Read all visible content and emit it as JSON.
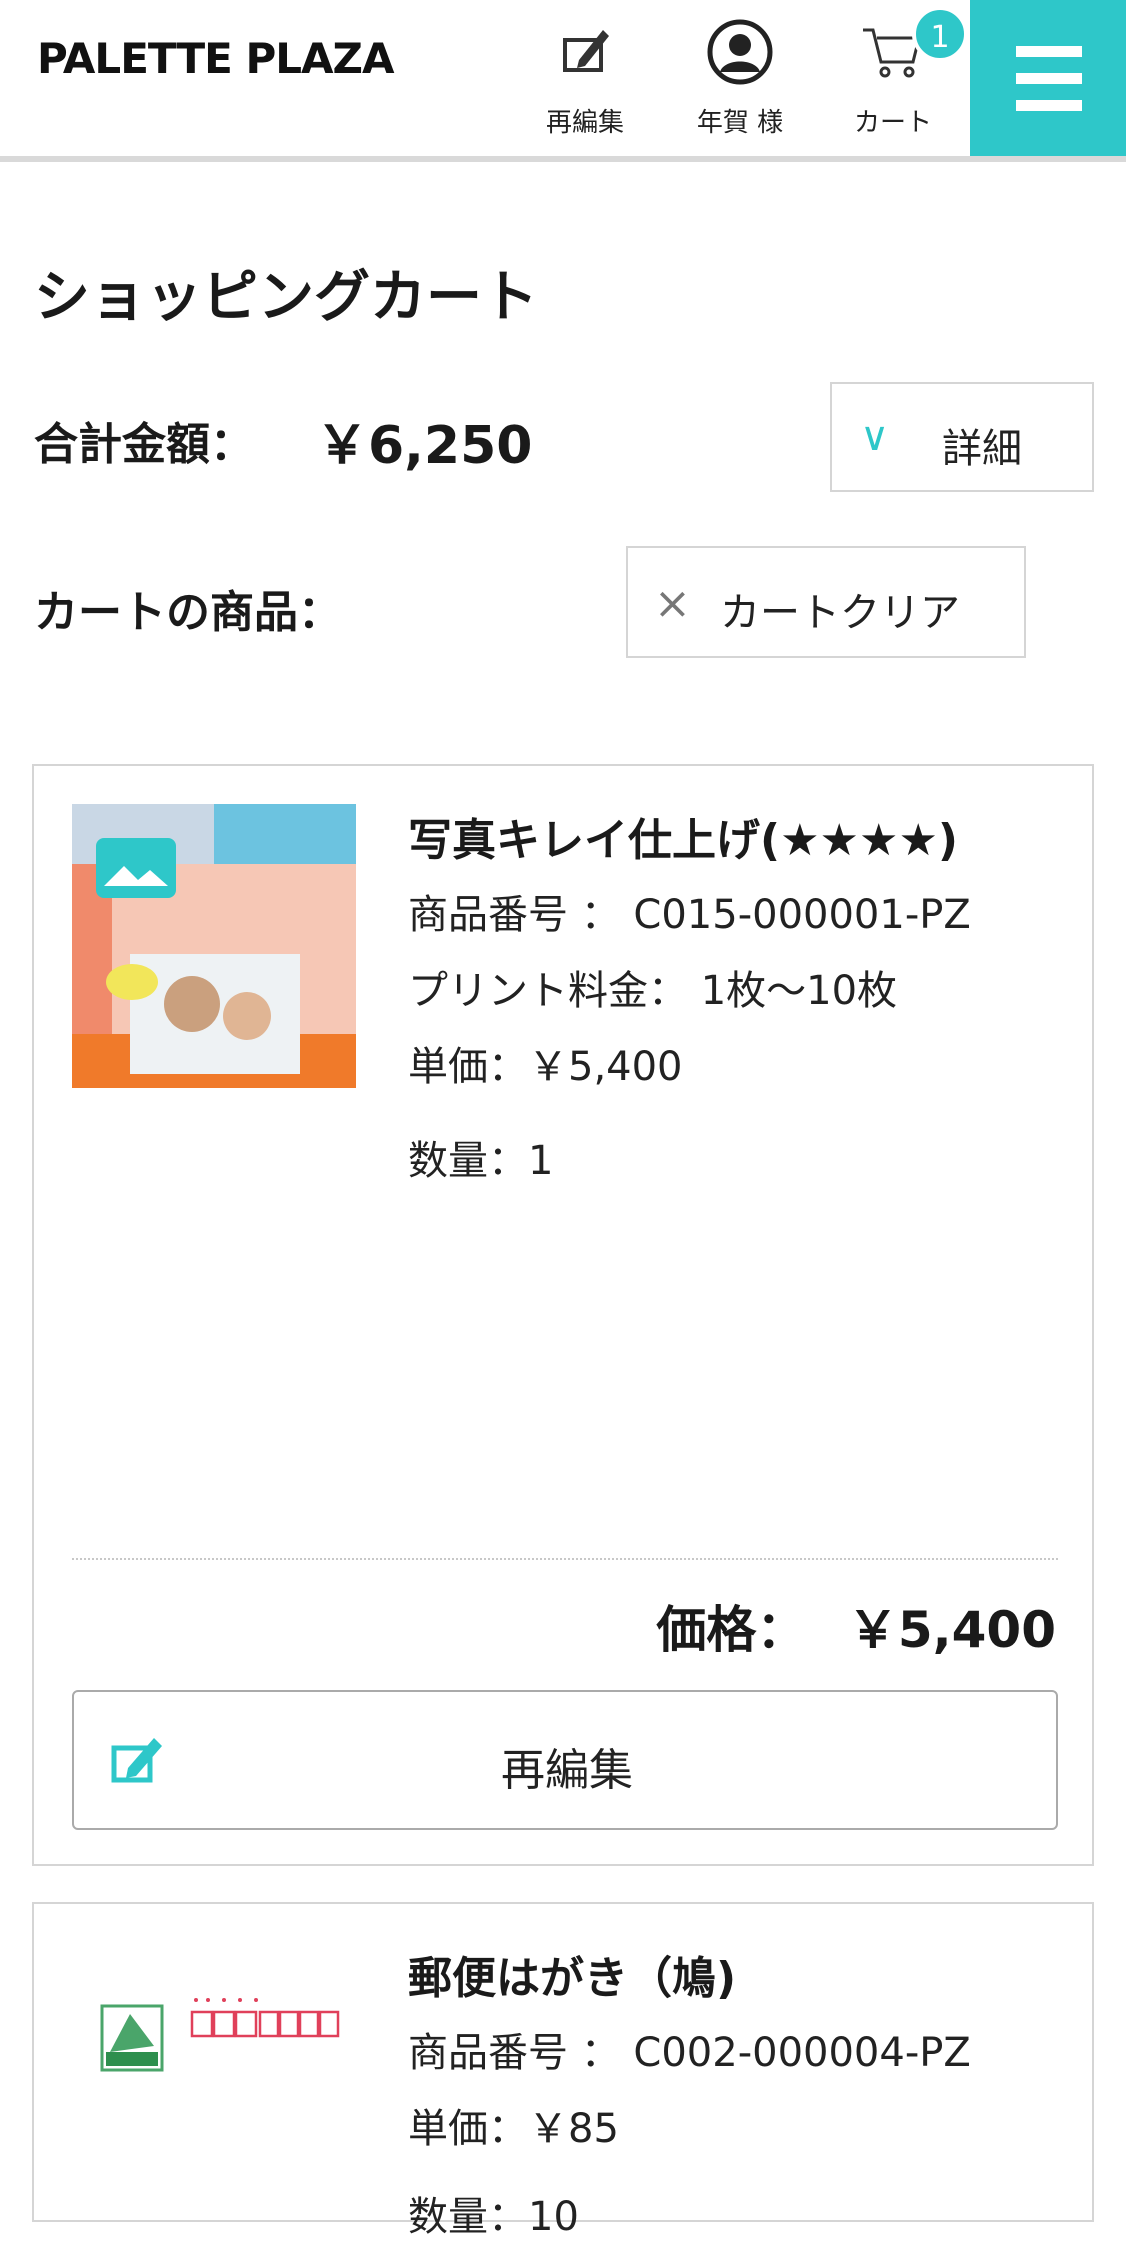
{
  "header": {
    "logo": "PALETTE PLAZA",
    "reedit_label": "再編集",
    "user_label": "年賀 様",
    "cart_label": "カート",
    "cart_count": "1",
    "accent_color": "#2ec7c9"
  },
  "page": {
    "title": "ショッピングカート",
    "total_label": "合計金額：",
    "total_value": "￥6,250",
    "detail_button": "詳細",
    "items_label": "カートの商品：",
    "clear_button": "カートクリア"
  },
  "items": [
    {
      "name": "写真キレイ仕上げ(★★★★)",
      "product_no": "商品番号 ： C015-000001-PZ",
      "print_fee": "プリント料金： 1枚～10枚",
      "unit_price": "単価：￥5,400",
      "quantity": "数量：1",
      "price_label": "価格：",
      "price_value": "￥5,400",
      "reedit_button": "再編集"
    },
    {
      "name": "郵便はがき（鳩)",
      "product_no": "商品番号 ： C002-000004-PZ",
      "unit_price": "単価：￥85",
      "quantity": "数量：10"
    }
  ]
}
